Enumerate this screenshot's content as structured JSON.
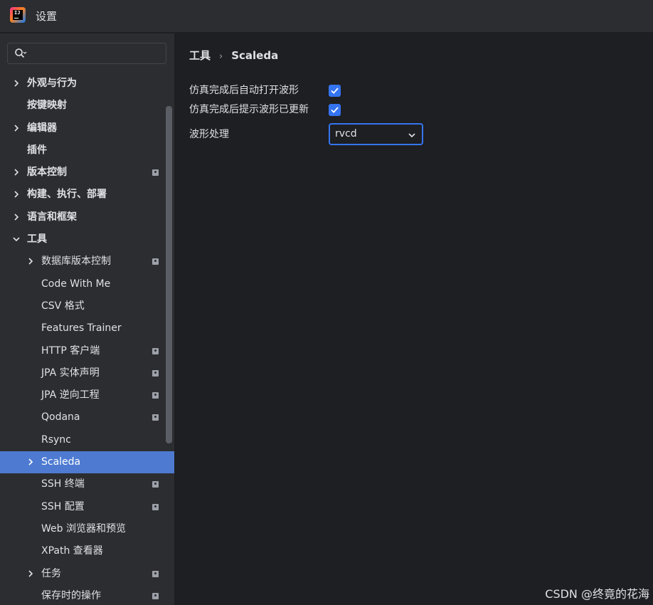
{
  "window": {
    "title": "设置"
  },
  "search": {
    "placeholder": "",
    "icon": "search-icon"
  },
  "sidebar": {
    "items": [
      {
        "label": "外观与行为",
        "level": 0,
        "chevron": "right",
        "bold": true,
        "project_icon": false
      },
      {
        "label": "按键映射",
        "level": 0,
        "chevron": "none",
        "bold": true,
        "project_icon": false
      },
      {
        "label": "编辑器",
        "level": 0,
        "chevron": "right",
        "bold": true,
        "project_icon": false
      },
      {
        "label": "插件",
        "level": 0,
        "chevron": "none",
        "bold": true,
        "project_icon": false
      },
      {
        "label": "版本控制",
        "level": 0,
        "chevron": "right",
        "bold": true,
        "project_icon": true
      },
      {
        "label": "构建、执行、部署",
        "level": 0,
        "chevron": "right",
        "bold": true,
        "project_icon": false
      },
      {
        "label": "语言和框架",
        "level": 0,
        "chevron": "right",
        "bold": true,
        "project_icon": false
      },
      {
        "label": "工具",
        "level": 0,
        "chevron": "down",
        "bold": true,
        "project_icon": false
      },
      {
        "label": "数据库版本控制",
        "level": 1,
        "chevron": "right",
        "bold": false,
        "project_icon": true
      },
      {
        "label": "Code With Me",
        "level": 1,
        "chevron": "none",
        "bold": false,
        "project_icon": false
      },
      {
        "label": "CSV 格式",
        "level": 1,
        "chevron": "none",
        "bold": false,
        "project_icon": false
      },
      {
        "label": "Features Trainer",
        "level": 1,
        "chevron": "none",
        "bold": false,
        "project_icon": false
      },
      {
        "label": "HTTP 客户端",
        "level": 1,
        "chevron": "none",
        "bold": false,
        "project_icon": true
      },
      {
        "label": "JPA 实体声明",
        "level": 1,
        "chevron": "none",
        "bold": false,
        "project_icon": true
      },
      {
        "label": "JPA 逆向工程",
        "level": 1,
        "chevron": "none",
        "bold": false,
        "project_icon": true
      },
      {
        "label": "Qodana",
        "level": 1,
        "chevron": "none",
        "bold": false,
        "project_icon": true
      },
      {
        "label": "Rsync",
        "level": 1,
        "chevron": "none",
        "bold": false,
        "project_icon": false
      },
      {
        "label": "Scaleda",
        "level": 1,
        "chevron": "right",
        "bold": false,
        "project_icon": false,
        "selected": true
      },
      {
        "label": "SSH 终端",
        "level": 1,
        "chevron": "none",
        "bold": false,
        "project_icon": true
      },
      {
        "label": "SSH 配置",
        "level": 1,
        "chevron": "none",
        "bold": false,
        "project_icon": true
      },
      {
        "label": "Web 浏览器和预览",
        "level": 1,
        "chevron": "none",
        "bold": false,
        "project_icon": false
      },
      {
        "label": "XPath 查看器",
        "level": 1,
        "chevron": "none",
        "bold": false,
        "project_icon": false
      },
      {
        "label": "任务",
        "level": 1,
        "chevron": "right",
        "bold": false,
        "project_icon": true
      },
      {
        "label": "保存时的操作",
        "level": 1,
        "chevron": "none",
        "bold": false,
        "project_icon": true
      }
    ]
  },
  "breadcrumb": {
    "parent": "工具",
    "separator": "›",
    "current": "Scaleda"
  },
  "settings": {
    "auto_open_waveform": {
      "label": "仿真完成后自动打开波形",
      "checked": true
    },
    "notify_waveform_updated": {
      "label": "仿真完成后提示波形已更新",
      "checked": true
    },
    "waveform_processing": {
      "label": "波形处理",
      "value": "rvcd"
    }
  },
  "watermark": "CSDN @终竟的花海",
  "colors": {
    "accent": "#3574f0",
    "selection": "#4e7bd1",
    "sidebar_bg": "#2b2d30",
    "content_bg": "#1e1f22"
  }
}
